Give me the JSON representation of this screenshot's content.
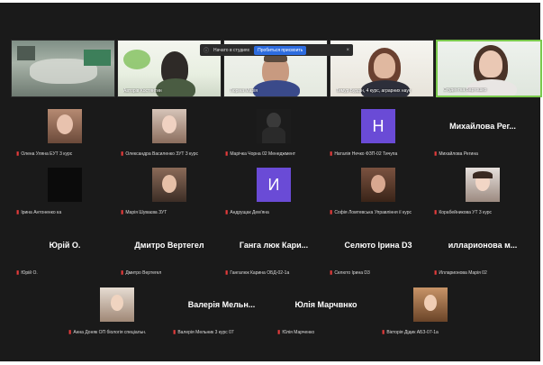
{
  "notification": {
    "text": "Начато в студиях",
    "button_label": "Пробиться присвоить",
    "close_glyph": "×"
  },
  "video_strip": [
    {
      "label": ""
    },
    {
      "label": "Авторів Костянтин"
    },
    {
      "label": "Тюріна Марія"
    },
    {
      "label": "Тимур Бурдін, 4 курс, аграрних наук"
    },
    {
      "label": "Студентка Бартошко"
    }
  ],
  "row1": [
    {
      "kind": "photo",
      "name": "Олена Уляна ЕУТ 3 курс"
    },
    {
      "kind": "photo",
      "name": "Олександра Василенко ЗУТ 3 курс"
    },
    {
      "kind": "photo",
      "name": "Марічка Чорна 02 Менеджмент"
    },
    {
      "kind": "initial",
      "initial": "Н",
      "name": "Наталія Нечко ФЗП-02 Тичупа"
    },
    {
      "kind": "text",
      "display": "Михайлова Рег...",
      "name": "Михайлова Регина"
    }
  ],
  "row2": [
    {
      "kind": "dark",
      "name": "Ірина Антоненко ка"
    },
    {
      "kind": "photo",
      "name": "Марія Шуваєва ЗУТ"
    },
    {
      "kind": "initial",
      "initial": "И",
      "name": "Андрущак Дем'яна"
    },
    {
      "kind": "photo",
      "name": "Софія Ломтевська Управління ії курс"
    },
    {
      "kind": "photo",
      "name": "Корабейникова УТ 3 курс"
    }
  ],
  "row3": [
    {
      "display": "Юрій О.",
      "name": "Юрій О."
    },
    {
      "display": "Дмитро Вертегел",
      "name": "Дмитро Вертегел"
    },
    {
      "display": "Ганга люк  Кари...",
      "name": "Гангалюк Карина ОБД-02-1а"
    },
    {
      "display": "Селюто Ірина D3",
      "name": "Селюто Ірина D3"
    },
    {
      "display": "илларионова  м...",
      "name": "Илларионова Марія 02"
    }
  ],
  "row4": [
    {
      "kind": "photo",
      "name": "Анна Доняк ОП біологія спеціальн."
    },
    {
      "kind": "text",
      "display": "Валерія  Мельн...",
      "name": "Валерія Мельник 3 курс 07"
    },
    {
      "kind": "text",
      "display": "Юлія Марчвнко",
      "name": "Юлія Марченко"
    },
    {
      "kind": "photo",
      "name": "Вікторія Дідик АБЗ-07-1а"
    }
  ]
}
